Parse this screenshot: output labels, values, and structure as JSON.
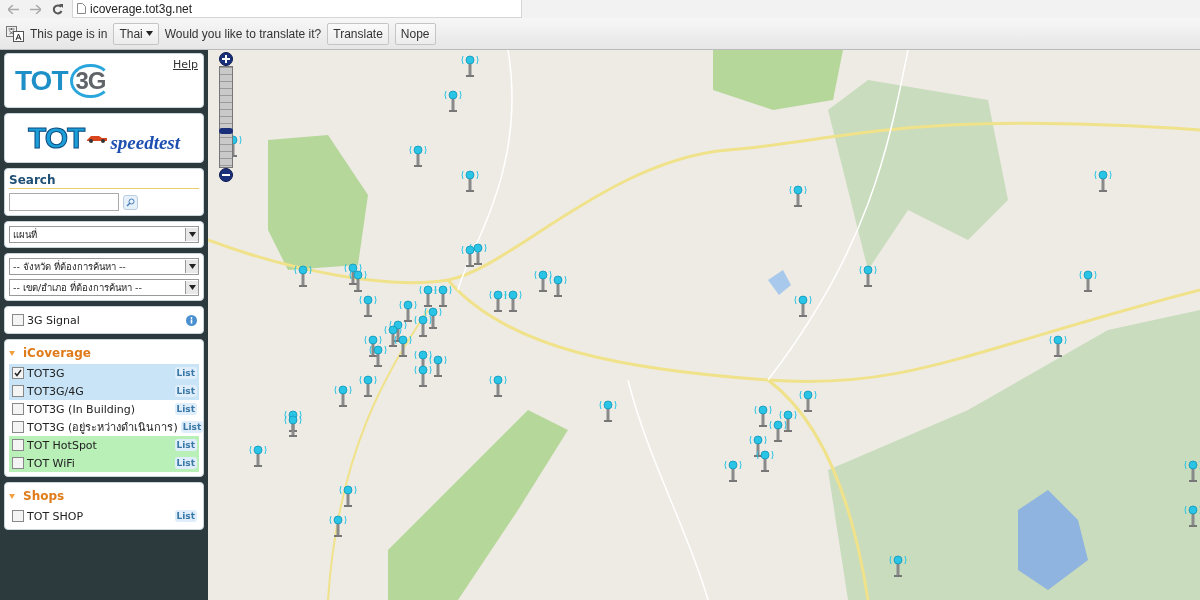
{
  "browser": {
    "url": "icoverage.tot3g.net"
  },
  "translate_bar": {
    "prefix": "This page is in",
    "language": "Thai",
    "question": "Would you like to translate it?",
    "buttons": [
      "Translate",
      "Nope"
    ]
  },
  "sidebar": {
    "logo": {
      "main": "TOT",
      "suffix": "3G",
      "help": "Help"
    },
    "banner": {
      "main": "TOT",
      "sub": "speedtest"
    },
    "search": {
      "title": "Search"
    },
    "map_type": {
      "value": "แผนที่"
    },
    "province": {
      "value": "-- จังหวัด ที่ต้องการค้นหา --"
    },
    "district": {
      "value": "-- เขต/อำเภอ ที่ต้องการค้นหา --"
    },
    "signal": {
      "label": "3G Signal",
      "checked": false
    },
    "sections": [
      {
        "title": "iCoverage",
        "expanded": true,
        "items": [
          {
            "label": "TOT3G",
            "checked": true,
            "color": "#c8e4f6",
            "action": "List"
          },
          {
            "label": "TOT3G/4G",
            "checked": false,
            "color": "#c8e4f6",
            "action": "List"
          },
          {
            "label": "TOT3G (In Building)",
            "checked": false,
            "action": "List"
          },
          {
            "label": "TOT3G (อยู่ระหว่างดำเนินการ)",
            "checked": false,
            "action": "List"
          },
          {
            "label": "TOT HotSpot",
            "checked": false,
            "color": "#b8f0b8",
            "action": "List"
          },
          {
            "label": "TOT WiFi",
            "checked": false,
            "color": "#b8f0b8",
            "action": "List"
          }
        ]
      },
      {
        "title": "Shops",
        "expanded": true,
        "items": [
          {
            "label": "TOT SHOP",
            "checked": false,
            "action": "List"
          }
        ]
      }
    ]
  },
  "map": {
    "zoom": {
      "level": 0.35
    }
  }
}
